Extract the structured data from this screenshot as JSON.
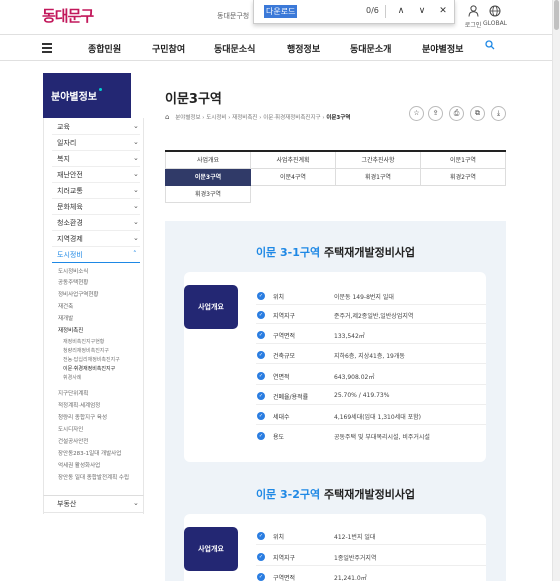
{
  "header": {
    "logo": "동대문구",
    "site_name": "동대문구청",
    "find": {
      "query": "다운로드",
      "count": "0/6",
      "prev": "∧",
      "next": "∨",
      "close": "✕"
    },
    "login": "로그인",
    "global": "GLOBAL"
  },
  "nav": [
    "종합민원",
    "구민참여",
    "동대문소식",
    "행정정보",
    "동대문소개",
    "분야별정보"
  ],
  "sidebar": {
    "title": "분야별정보",
    "items": [
      "교육",
      "일자리",
      "복지",
      "재난안전",
      "치러교통",
      "문화체육",
      "청소환경",
      "지역경제",
      "도시정비"
    ],
    "sub": [
      "도시정비소식",
      "공동주택현황",
      "정비사업구역현황",
      "재건축",
      "재개발",
      "재정비촉진"
    ],
    "subsub": [
      "재정비촉진지구현황",
      "청량리재정비촉진지구",
      "전농·답십리재정비촉진지구",
      "이문·휘경재정비촉진지구",
      "휘경사례"
    ],
    "sub2": [
      "지구단위계획",
      "적정계획·세계엄정",
      "청량리 종합지구 육성",
      "도시디자인",
      "건설공사안전",
      "장안동283-1일대 개발사업",
      "억세권 활성화사업",
      "장안동 일대 종합발전계획 수립"
    ],
    "last": "부동산"
  },
  "page": {
    "title": "이문3구역",
    "breadcrumb": [
      "분야별정보",
      "도시정비",
      "재정비촉진",
      "이문·휘경재정비촉진지구",
      "이문3구역"
    ],
    "tools": [
      "star-icon",
      "share-icon",
      "print-icon",
      "copy-icon",
      "download-icon"
    ]
  },
  "tabs": [
    "사업개요",
    "사업추진계획",
    "그간추진사항",
    "이문1구역",
    "이문3구역",
    "이문4구역",
    "휘경1구역",
    "휘경2구역",
    "휘경3구역"
  ],
  "sections": [
    {
      "title_blue": "이문 3-1구역",
      "title_rest": "주택재개발정비사업",
      "badge": "사업개요",
      "rows": [
        {
          "label": "위치",
          "value": "이문동 149-8번지 일대"
        },
        {
          "label": "지역지구",
          "value": "준주거,제2종일반,일반상업지역"
        },
        {
          "label": "구역면적",
          "value": "133,542㎡"
        },
        {
          "label": "건축규모",
          "value": "지하6층, 지상41층, 19개동"
        },
        {
          "label": "연면적",
          "value": "643,908.02㎡"
        },
        {
          "label": "건폐율/용적률",
          "value": "25.70% / 419.73%"
        },
        {
          "label": "세대수",
          "value": "4,169세대(임대 1,310세대 포함)"
        },
        {
          "label": "용도",
          "value": "공동주택 및 부대복리시설, 비주거시설"
        }
      ]
    },
    {
      "title_blue": "이문 3-2구역",
      "title_rest": "주택재개발정비사업",
      "badge": "사업개요",
      "rows": [
        {
          "label": "위치",
          "value": "412-1번지 일대"
        },
        {
          "label": "지역지구",
          "value": "1종일반주거지역"
        },
        {
          "label": "구역면적",
          "value": "21,241.0㎡"
        }
      ]
    }
  ],
  "colors": {
    "navy": "#232773",
    "active_tab": "#303a68",
    "accent": "#1e88e5",
    "content_bg": "#eef3f8"
  }
}
